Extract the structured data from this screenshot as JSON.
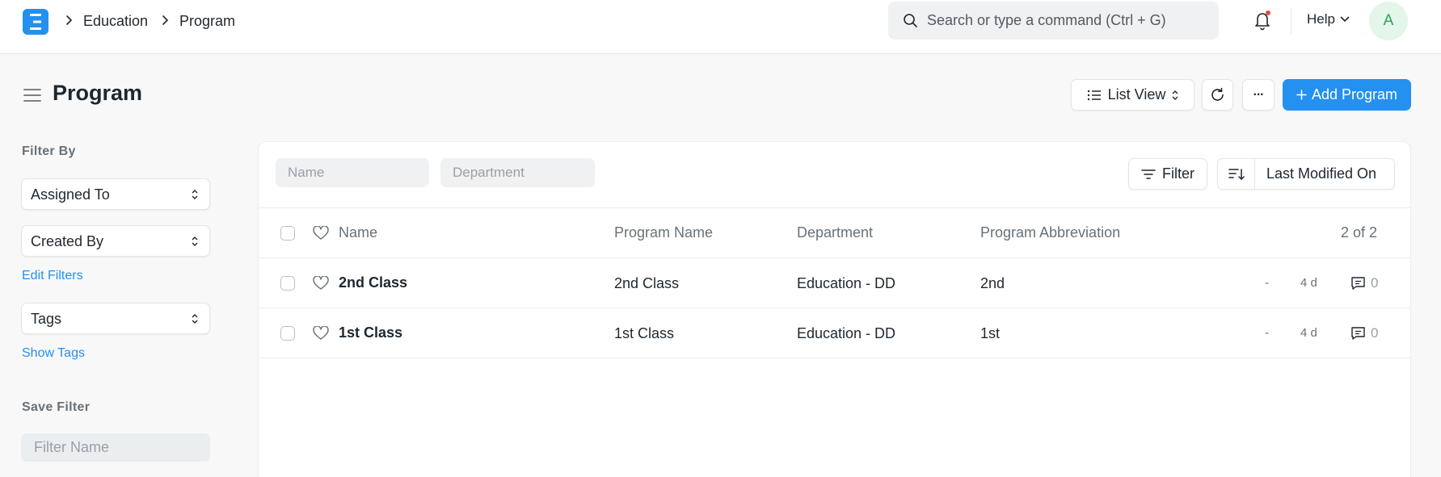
{
  "navbar": {
    "logo_letter": "E",
    "breadcrumbs": [
      "Education",
      "Program"
    ],
    "search_placeholder": "Search or type a command (Ctrl + G)",
    "help_label": "Help",
    "avatar_letter": "A"
  },
  "page": {
    "title": "Program",
    "view_label": "List View",
    "more_label": "···",
    "add_label": "Add Program"
  },
  "sidebar": {
    "filter_by_label": "Filter By",
    "assigned_to": "Assigned To",
    "created_by": "Created By",
    "edit_filters": "Edit Filters",
    "tags": "Tags",
    "show_tags": "Show Tags",
    "save_filter_label": "Save Filter",
    "filter_name_placeholder": "Filter Name"
  },
  "list": {
    "name_placeholder": "Name",
    "department_placeholder": "Department",
    "filter_label": "Filter",
    "sort_label": "Last Modified On",
    "columns": [
      "Name",
      "Program Name",
      "Department",
      "Program Abbreviation"
    ],
    "count": "2 of 2",
    "rows": [
      {
        "name": "2nd Class",
        "program_name": "2nd Class",
        "department": "Education - DD",
        "abbreviation": "2nd",
        "assigned": "-",
        "modified": "4 d",
        "comments": "0"
      },
      {
        "name": "1st Class",
        "program_name": "1st Class",
        "department": "Education - DD",
        "abbreviation": "1st",
        "assigned": "-",
        "modified": "4 d",
        "comments": "0"
      }
    ]
  },
  "colors": {
    "primary": "#2490ef",
    "text": "#1f272e",
    "muted": "#687178",
    "avatar_bg": "#e4f5e9",
    "avatar_text": "#2f9e5b"
  }
}
